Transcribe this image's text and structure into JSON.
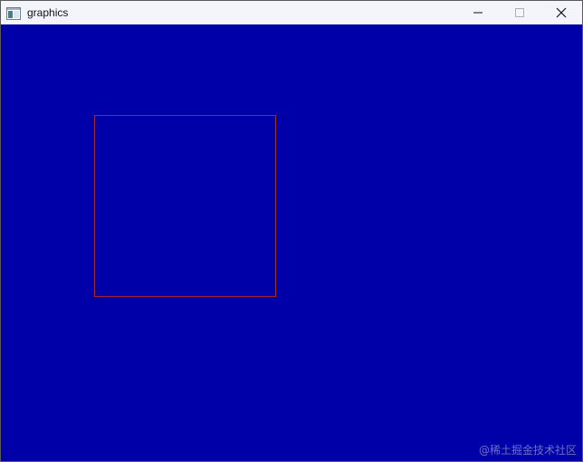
{
  "window": {
    "title": "graphics",
    "background_color": "#0000a8",
    "titlebar_color": "#f3f5fb",
    "icons": {
      "app": "app-window-icon",
      "minimize": "minimize-icon",
      "maximize": "maximize-icon",
      "close": "close-icon"
    }
  },
  "drawing": {
    "shape": "rectangle",
    "stroke_color": "#a8262e"
  },
  "watermark": {
    "text": "@稀土掘金技术社区"
  }
}
